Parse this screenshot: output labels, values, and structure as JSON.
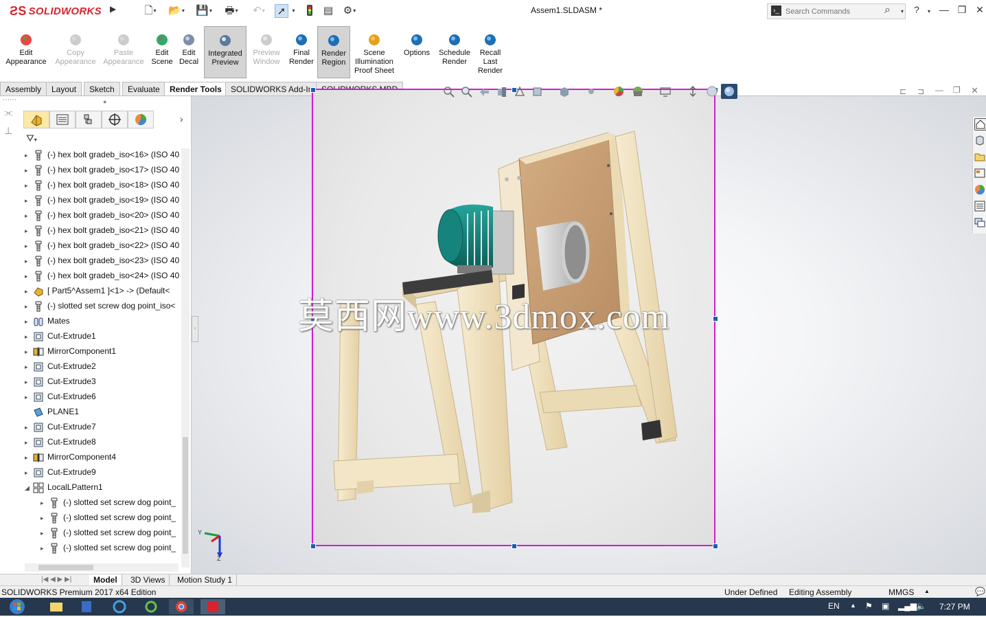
{
  "app": {
    "brand": "SOLIDWORKS",
    "document_title": "Assem1.SLDASM *"
  },
  "search": {
    "placeholder": "Search Commands"
  },
  "ribbon": {
    "buttons": [
      {
        "label": "Edit\nAppearance",
        "enabled": true
      },
      {
        "label": "Copy\nAppearance",
        "enabled": false
      },
      {
        "label": "Paste\nAppearance",
        "enabled": false
      },
      {
        "label": "Edit\nScene",
        "enabled": true
      },
      {
        "label": "Edit\nDecal",
        "enabled": true
      },
      {
        "label": "Integrated\nPreview",
        "enabled": true,
        "active": true
      },
      {
        "label": "Preview\nWindow",
        "enabled": false
      },
      {
        "label": "Final\nRender",
        "enabled": true
      },
      {
        "label": "Render\nRegion",
        "enabled": true,
        "active": true
      },
      {
        "label": "Scene\nIllumination\nProof Sheet",
        "enabled": true
      },
      {
        "label": "Options",
        "enabled": true
      },
      {
        "label": "Schedule\nRender",
        "enabled": true
      },
      {
        "label": "Recall\nLast\nRender",
        "enabled": true
      }
    ]
  },
  "tabs": [
    "Assembly",
    "Layout",
    "Sketch",
    "Evaluate",
    "Render Tools",
    "SOLIDWORKS Add-Ins",
    "SOLIDWORKS MBD"
  ],
  "active_tab": "Render Tools",
  "tree": [
    {
      "label": "(-) hex bolt gradeb_iso<16> (ISO 40",
      "icon": "bolt-icon",
      "indent": 0
    },
    {
      "label": "(-) hex bolt gradeb_iso<17> (ISO 40",
      "icon": "bolt-icon",
      "indent": 0
    },
    {
      "label": "(-) hex bolt gradeb_iso<18> (ISO 40",
      "icon": "bolt-icon",
      "indent": 0
    },
    {
      "label": "(-) hex bolt gradeb_iso<19> (ISO 40",
      "icon": "bolt-icon",
      "indent": 0
    },
    {
      "label": "(-) hex bolt gradeb_iso<20> (ISO 40",
      "icon": "bolt-icon",
      "indent": 0
    },
    {
      "label": "(-) hex bolt gradeb_iso<21> (ISO 40",
      "icon": "bolt-icon",
      "indent": 0
    },
    {
      "label": "(-) hex bolt gradeb_iso<22> (ISO 40",
      "icon": "bolt-icon",
      "indent": 0
    },
    {
      "label": "(-) hex bolt gradeb_iso<23> (ISO 40",
      "icon": "bolt-icon",
      "indent": 0
    },
    {
      "label": "(-) hex bolt gradeb_iso<24> (ISO 40",
      "icon": "bolt-icon",
      "indent": 0
    },
    {
      "label": "[ Part5^Assem1 ]<1> -> (Default<",
      "icon": "part-icon",
      "indent": 0
    },
    {
      "label": "(-) slotted set screw dog point_iso<",
      "icon": "bolt-icon",
      "indent": 0
    },
    {
      "label": "Mates",
      "icon": "mates-icon",
      "indent": 0
    },
    {
      "label": "Cut-Extrude1",
      "icon": "cut-extrude-icon",
      "indent": 0
    },
    {
      "label": "MirrorComponent1",
      "icon": "mirror-icon",
      "indent": 0
    },
    {
      "label": "Cut-Extrude2",
      "icon": "cut-extrude-icon",
      "indent": 0
    },
    {
      "label": "Cut-Extrude3",
      "icon": "cut-extrude-icon",
      "indent": 0
    },
    {
      "label": "Cut-Extrude6",
      "icon": "cut-extrude-icon",
      "indent": 0
    },
    {
      "label": "PLANE1",
      "icon": "plane-icon",
      "indent": 0
    },
    {
      "label": "Cut-Extrude7",
      "icon": "cut-extrude-icon",
      "indent": 0
    },
    {
      "label": "Cut-Extrude8",
      "icon": "cut-extrude-icon",
      "indent": 0
    },
    {
      "label": "MirrorComponent4",
      "icon": "mirror-icon",
      "indent": 0
    },
    {
      "label": "Cut-Extrude9",
      "icon": "cut-extrude-icon",
      "indent": 0
    },
    {
      "label": "LocalLPattern1",
      "icon": "pattern-icon",
      "indent": 0,
      "expanded": true
    },
    {
      "label": "(-) slotted set screw dog point_",
      "icon": "bolt-icon",
      "indent": 1
    },
    {
      "label": "(-) slotted set screw dog point_",
      "icon": "bolt-icon",
      "indent": 1
    },
    {
      "label": "(-) slotted set screw dog point_",
      "icon": "bolt-icon",
      "indent": 1
    },
    {
      "label": "(-) slotted set screw dog point_",
      "icon": "bolt-icon",
      "indent": 1
    }
  ],
  "bottom_tabs": [
    "Model",
    "3D Views",
    "Motion Study 1"
  ],
  "status": {
    "edition": "SOLIDWORKS Premium 2017 x64 Edition",
    "state": "Under Defined",
    "mode": "Editing Assembly",
    "units": "MMGS"
  },
  "taskbar": {
    "lang": "EN",
    "time": "7:27 PM"
  },
  "watermark": "莫西网www.3dmox.com",
  "triad": {
    "y": "Y",
    "z": "Z"
  },
  "colors": {
    "render_region": "#d21bd2",
    "accent": "#d9232d",
    "motor": "#0f8a83",
    "wood": "#f0e2c0",
    "plywood": "#c9a27a"
  }
}
